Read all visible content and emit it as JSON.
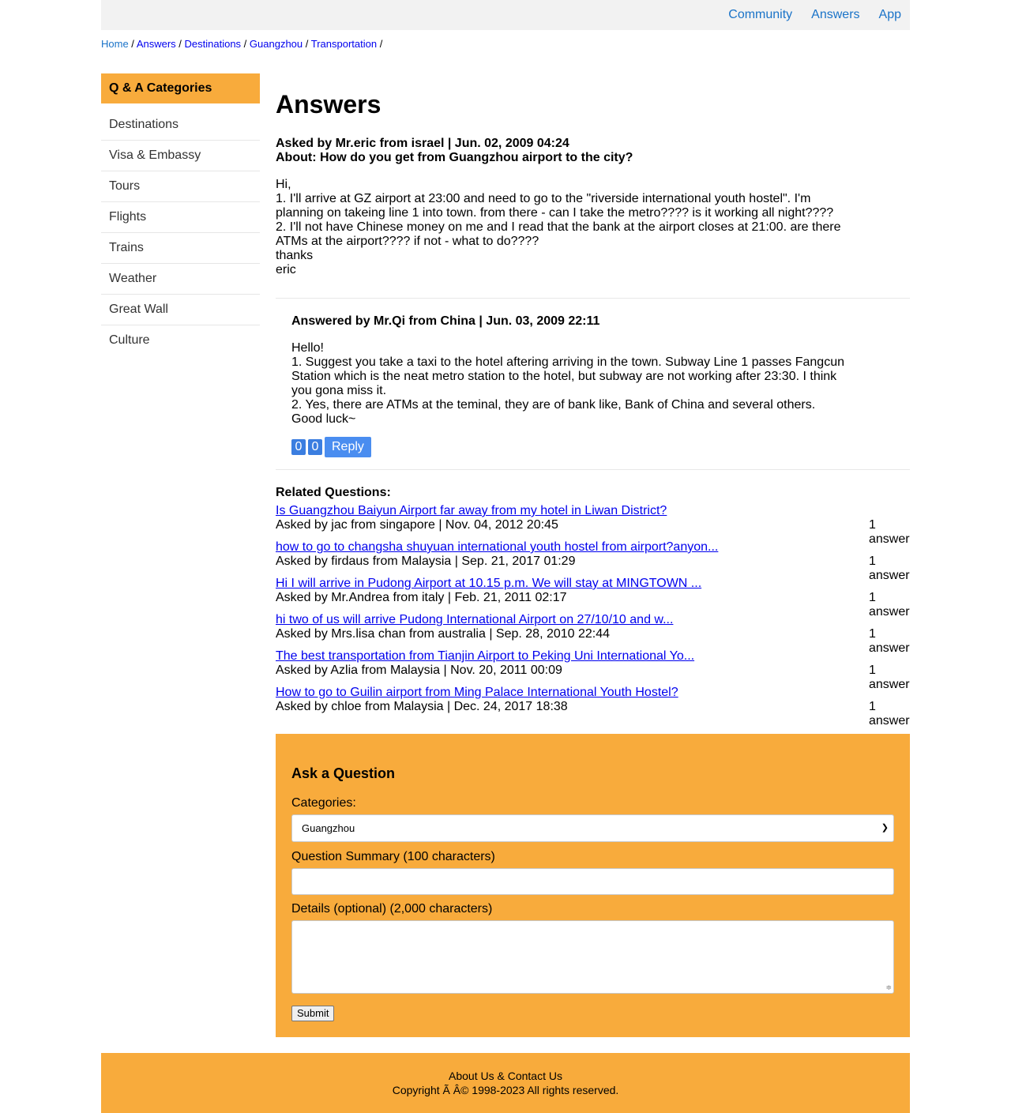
{
  "topnav": {
    "items": [
      "Community",
      "Answers",
      "App"
    ]
  },
  "breadcrumb": [
    "Home",
    "Answers",
    "Destinations",
    "Guangzhou",
    "Transportation"
  ],
  "sidebar": {
    "title": "Q & A Categories",
    "items": [
      "Destinations",
      "Visa & Embassy",
      "Tours",
      "Flights",
      "Trains",
      "Weather",
      "Great Wall",
      "Culture"
    ]
  },
  "page": {
    "heading": "Answers"
  },
  "question": {
    "asked_line": "Asked by Mr.eric from israel | Jun. 02, 2009 04:24",
    "about_line": "About: How do you get from Guangzhou airport to the city?",
    "body": [
      "Hi,",
      "1. I'll arrive at GZ airport at 23:00 and need to go to the \"riverside international youth hostel\". I'm planning on takeing line 1 into town. from there - can I take the metro???? is it working all night????",
      "2. I'll not have Chinese money on me and I read that the bank at the airport closes at 21:00. are there ATMs at the airport???? if not - what to do????",
      "thanks",
      "eric"
    ]
  },
  "answer": {
    "answered_line": "Answered by Mr.Qi from China | Jun. 03, 2009 22:11",
    "body": [
      "Hello!",
      "1. Suggest you take a taxi to the hotel aftering arriving in the town. Subway Line 1 passes Fangcun Station which is the neat metro station to the hotel, but subway are not working after 23:30. I think you gona miss it.",
      "2. Yes, there are ATMs at the teminal, they are of bank like, Bank of China and several others.",
      "Good luck~"
    ],
    "upvotes": "0",
    "downvotes": "0",
    "reply_label": "Reply"
  },
  "related": {
    "title": "Related Questions:",
    "items": [
      {
        "title": "Is Guangzhou Baiyun Airport far away from my hotel in Liwan District?",
        "asked": "Asked by jac from singapore | Nov. 04, 2012 20:45",
        "count": "1 answer"
      },
      {
        "title": "how to go to changsha shuyuan international youth hostel from airport?anyon...",
        "asked": "Asked by firdaus from Malaysia | Sep. 21, 2017 01:29",
        "count": "1 answer"
      },
      {
        "title": "Hi I will arrive in Pudong Airport at 10.15 p.m. We will stay at MINGTOWN ...",
        "asked": "Asked by Mr.Andrea from italy | Feb. 21, 2011 02:17",
        "count": "1 answer"
      },
      {
        "title": "hi two of us will arrive Pudong International Airport on 27/10/10 and w...",
        "asked": "Asked by Mrs.lisa chan from australia | Sep. 28, 2010 22:44",
        "count": "1 answer"
      },
      {
        "title": "The best transportation from Tianjin Airport to Peking Uni International Yo...",
        "asked": "Asked by Azlia from Malaysia | Nov. 20, 2011 00:09",
        "count": "1 answer"
      },
      {
        "title": "How to go to Guilin airport from Ming Palace International Youth Hostel?",
        "asked": "Asked by chloe from Malaysia | Dec. 24, 2017 18:38",
        "count": "1 answer"
      }
    ]
  },
  "ask_form": {
    "title": "Ask a Question",
    "categories_label": "Categories:",
    "category_selected": "Guangzhou",
    "summary_label": "Question Summary (100 characters)",
    "summary_value": "",
    "details_label": "Details (optional) (2,000 characters)",
    "details_value": "",
    "submit_label": "Submit"
  },
  "footer": {
    "links": "About Us & Contact Us",
    "copyright": "Copyright Ã   Â© 1998-2023 All rights reserved."
  },
  "colors": {
    "accent": "#f8ab3c",
    "link": "#0000ee",
    "nav_link": "#1a73c8",
    "button": "#4a8df0"
  }
}
